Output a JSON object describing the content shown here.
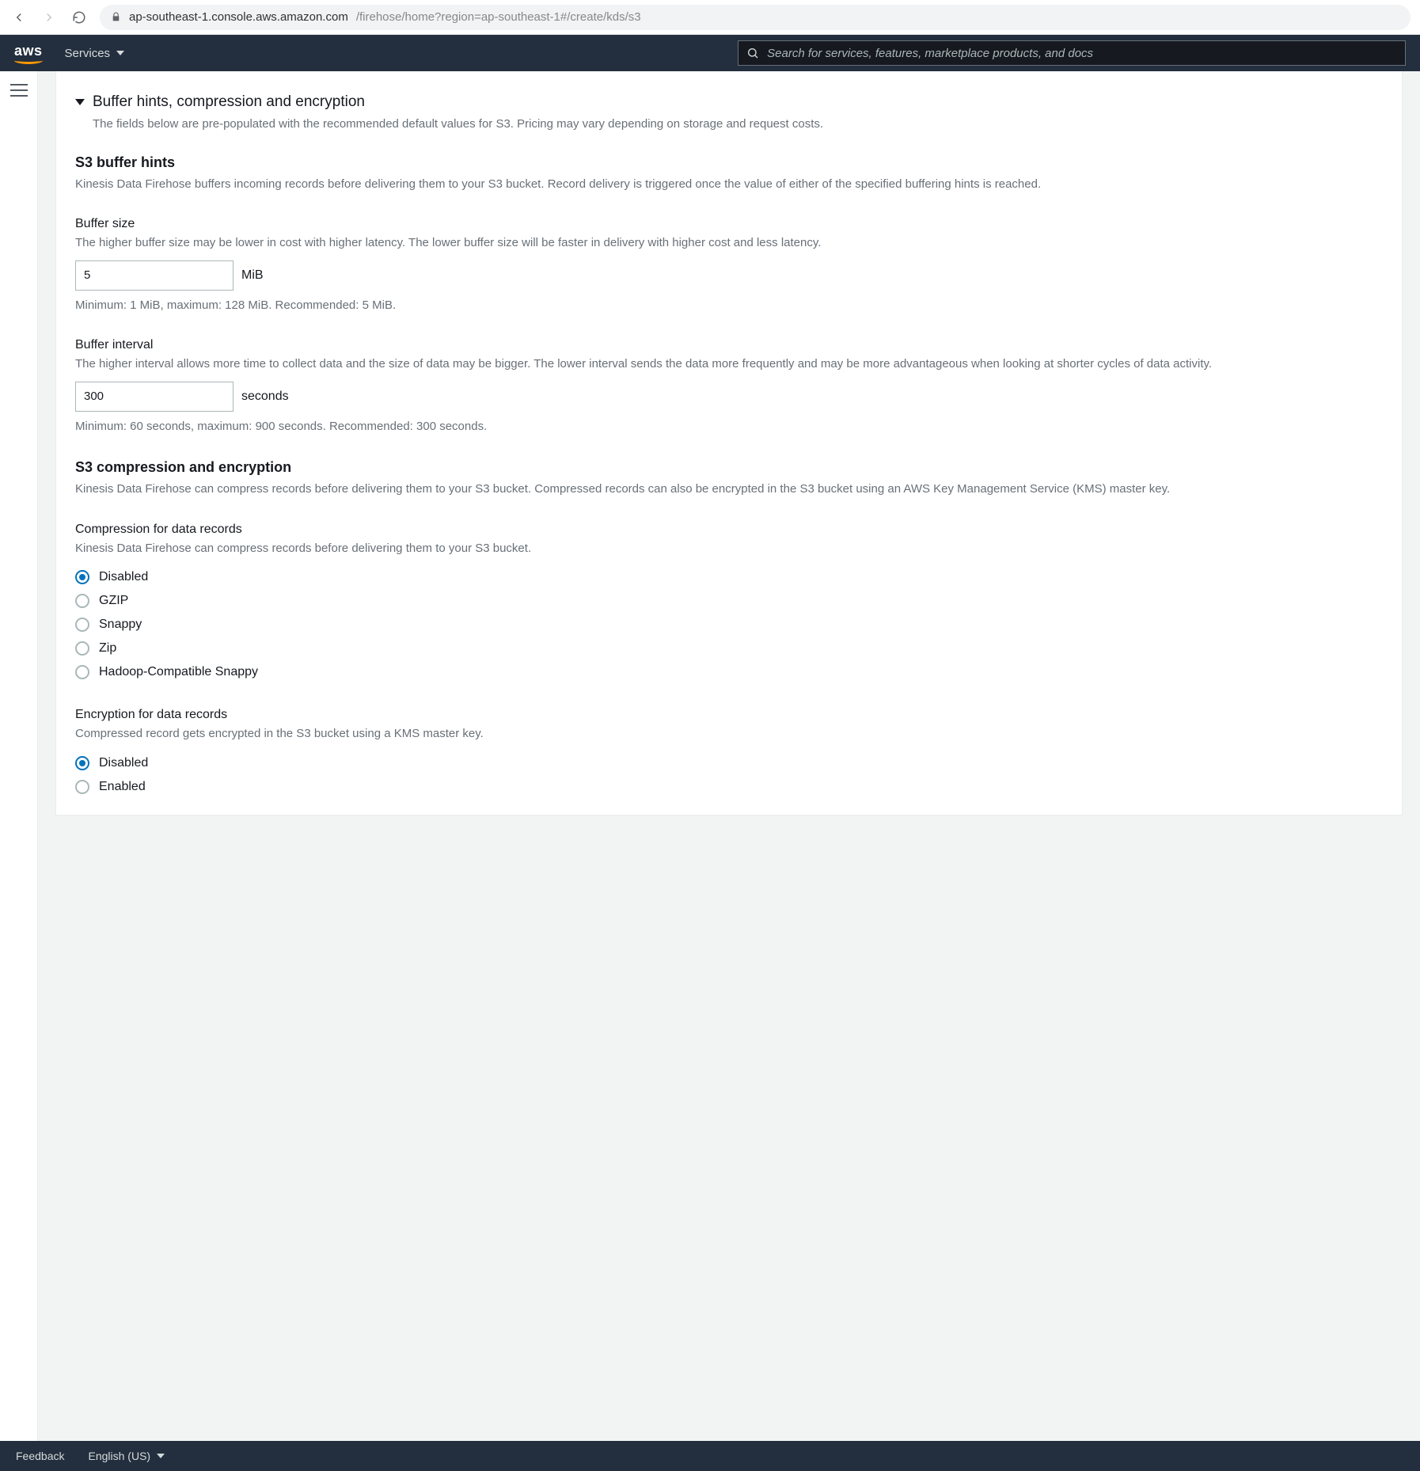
{
  "browser": {
    "url_host": "ap-southeast-1.console.aws.amazon.com",
    "url_path": "/firehose/home?region=ap-southeast-1#/create/kds/s3"
  },
  "nav": {
    "services": "Services",
    "search_placeholder": "Search for services, features, marketplace products, and docs"
  },
  "panel": {
    "heading": "Buffer hints, compression and encryption",
    "heading_desc": "The fields below are pre-populated with the recommended default values for S3. Pricing may vary depending on storage and request costs.",
    "buffer_hints": {
      "title": "S3 buffer hints",
      "desc": "Kinesis Data Firehose buffers incoming records before delivering them to your S3 bucket. Record delivery is triggered once the value of either of the specified buffering hints is reached."
    },
    "buffer_size": {
      "label": "Buffer size",
      "desc": "The higher buffer size may be lower in cost with higher latency. The lower buffer size will be faster in delivery with higher cost and less latency.",
      "value": "5",
      "unit": "MiB",
      "hint": "Minimum: 1 MiB, maximum: 128 MiB. Recommended: 5 MiB."
    },
    "buffer_interval": {
      "label": "Buffer interval",
      "desc": "The higher interval allows more time to collect data and the size of data may be bigger. The lower interval sends the data more frequently and may be more advantageous when looking at shorter cycles of data activity.",
      "value": "300",
      "unit": "seconds",
      "hint": "Minimum: 60 seconds, maximum: 900 seconds. Recommended: 300 seconds."
    },
    "compenc": {
      "title": "S3 compression and encryption",
      "desc": "Kinesis Data Firehose can compress records before delivering them to your S3 bucket. Compressed records can also be encrypted in the S3 bucket using an AWS Key Management Service (KMS) master key."
    },
    "compression": {
      "label": "Compression for data records",
      "desc": "Kinesis Data Firehose can compress records before delivering them to your S3 bucket.",
      "options": [
        "Disabled",
        "GZIP",
        "Snappy",
        "Zip",
        "Hadoop-Compatible Snappy"
      ],
      "selected": 0
    },
    "encryption": {
      "label": "Encryption for data records",
      "desc": "Compressed record gets encrypted in the S3 bucket using a KMS master key.",
      "options": [
        "Disabled",
        "Enabled"
      ],
      "selected": 0
    }
  },
  "footer": {
    "feedback": "Feedback",
    "language": "English (US)"
  }
}
